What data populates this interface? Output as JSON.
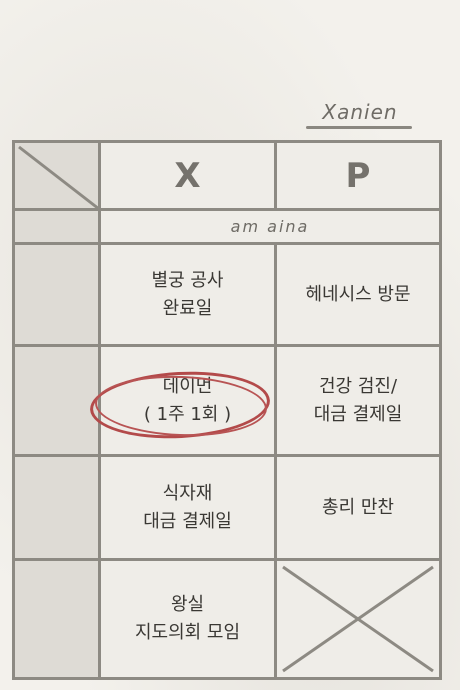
{
  "header": {
    "scribble_top": "Xanien",
    "col_x": "X",
    "col_p": "P",
    "sub_header": "am aina"
  },
  "rows": [
    {
      "left": "별궁 공사\n완료일",
      "right": "헤네시스 방문"
    },
    {
      "left": "데이먼\n( 1주 1회 )",
      "right": "건강 검진/\n대금 결제일"
    },
    {
      "left": "식자재\n대금 결제일",
      "right": "총리 만찬"
    },
    {
      "left": "왕실\n지도의회 모임",
      "right": ""
    }
  ]
}
